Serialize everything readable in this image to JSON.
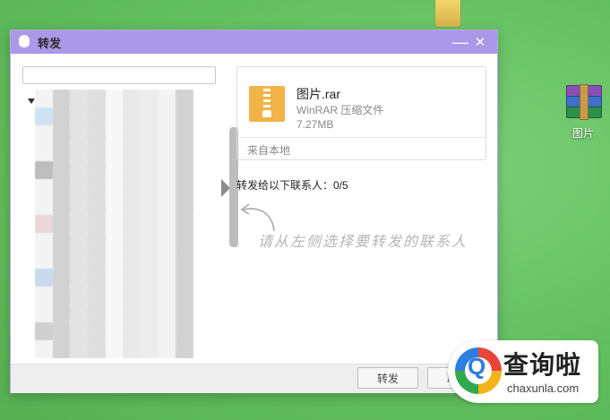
{
  "desktop": {
    "rar_icon_label": "图片"
  },
  "window": {
    "title": "转发",
    "min_symbol": "—",
    "close_symbol": "✕"
  },
  "search": {
    "value": "",
    "placeholder": ""
  },
  "file": {
    "name": "图片.rar",
    "type": "WinRAR 压缩文件",
    "size": "7.27MB",
    "source": "来自本地"
  },
  "forward": {
    "count_label": "转发给以下联系人：0/5",
    "hint": "请从左侧选择要转发的联系人"
  },
  "buttons": {
    "forward": "转发",
    "cancel": "取消"
  },
  "watermark": {
    "brand_cn": "查询啦",
    "brand_en": "chaxunla.com",
    "logo_letter": "Q"
  },
  "colors": {
    "titlebar": "#a999e8",
    "desktop": "#63c060",
    "zip_icon": "#f2b446"
  }
}
